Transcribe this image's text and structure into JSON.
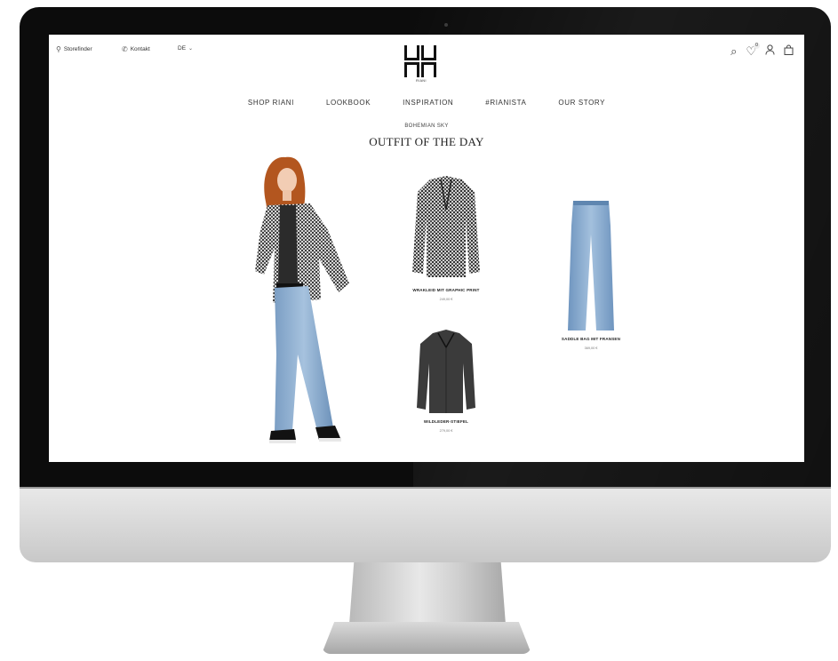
{
  "topbar": {
    "storefinder_label": "Storefinder",
    "kontakt_label": "Kontakt",
    "language_label": "DE",
    "brand_word": "RIANI",
    "wishlist_count": "0"
  },
  "nav": {
    "items": [
      "SHOP RIANI",
      "LOOKBOOK",
      "INSPIRATION",
      "#RIANISTA",
      "OUR STORY"
    ]
  },
  "hero": {
    "eyebrow": "BOHEMIAN SKY",
    "title": "OUTFIT OF THE DAY"
  },
  "products": [
    {
      "name": "WRAKLEID MIT GRAPHIC PRINT",
      "price": "249,00 €"
    },
    {
      "name": "WILDLEDER-STIEFEL",
      "price": "279,00 €"
    },
    {
      "name": "SADDLE BAG MIT FRANSEN",
      "price": "369,00 €"
    }
  ],
  "icons": {
    "storefinder": "location-pin-icon",
    "kontakt": "phone-icon",
    "language": "chevron-down-icon",
    "search": "search-icon",
    "wishlist": "heart-icon",
    "account": "user-icon",
    "bag": "shopping-bag-icon"
  }
}
